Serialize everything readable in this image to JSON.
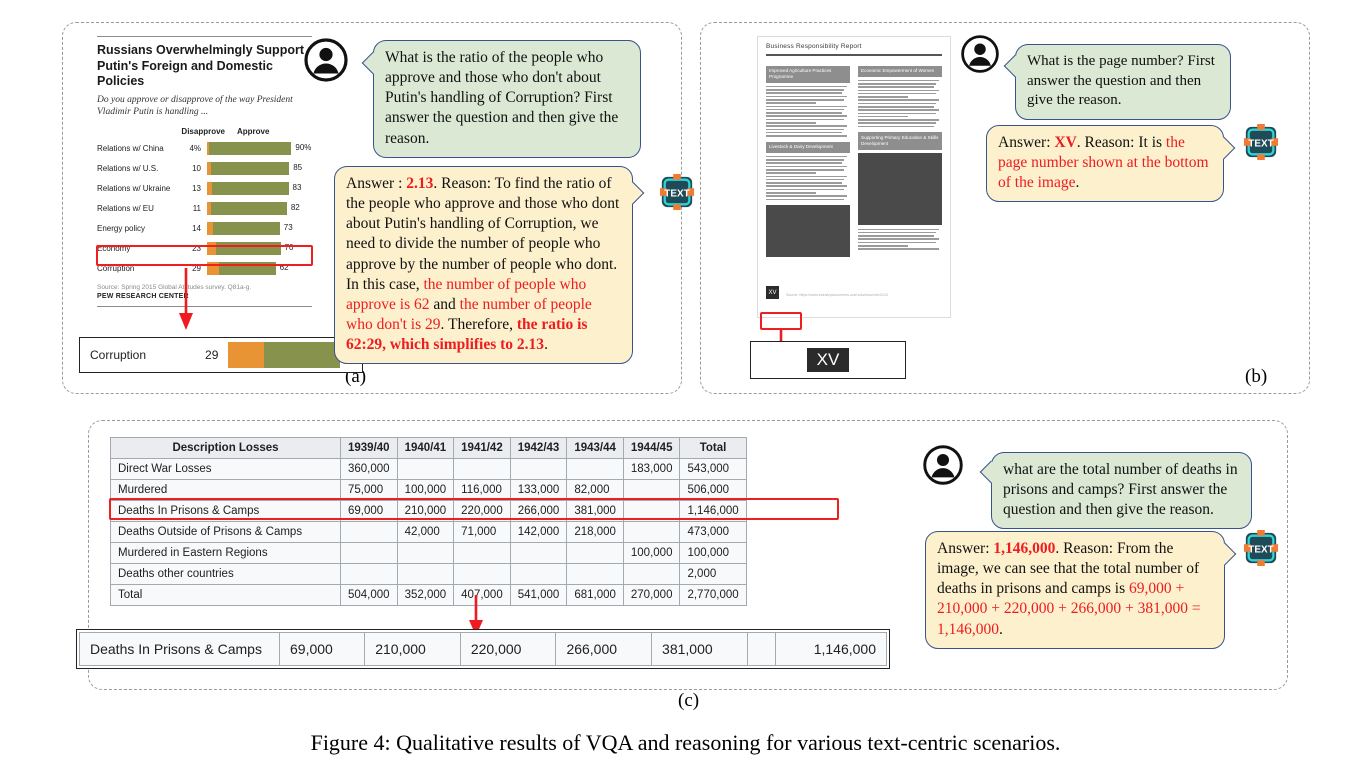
{
  "figure": {
    "caption": "Figure 4: Qualitative results of VQA and reasoning for various text-centric scenarios.",
    "panel_a_label": "(a)",
    "panel_b_label": "(b)",
    "panel_c_label": "(c)"
  },
  "colors": {
    "answer_red": "#ee1c20",
    "question_bubble": "#dbe8d4",
    "answer_bubble": "#fdf0cd",
    "bubble_border": "#38548c",
    "highlight_box": "#f01f1f",
    "bar_disapprove": "#e89434",
    "bar_approve": "#87924c"
  },
  "icons": {
    "user": "user-avatar-icon",
    "model": "text-model-icon",
    "model_label": "TEXT"
  },
  "panel_a": {
    "chart": {
      "title_line1": "Russians Overwhelmingly Support",
      "title_line2": "Putin's Foreign and Domestic Policies",
      "subtitle_line1": "Do you approve or disapprove of the way President",
      "subtitle_line2": "Vladimir Putin is handling ...",
      "col_disapprove": "Disapprove",
      "col_approve": "Approve",
      "source": "Source: Spring 2015 Global Attitudes survey. Q81a-g.",
      "org": "PEW RESEARCH CENTER"
    },
    "zoom_row": {
      "label": "Corruption",
      "disapprove": "29",
      "approve": "62"
    },
    "question": "What is the ratio of the people who approve and those who don't about Putin's handling of Corruption? First answer the question and then give the reason.",
    "answer": {
      "prefix": "Answer : ",
      "value": "2.13",
      "mid": ". Reason: To find the ratio of the people who approve and those who dont about Putin's handling of Corruption, we need to divide the number of people who approve by the number of people who dont. In this case, ",
      "red1": "the number of people who approve is 62",
      "joiner1": " and ",
      "red2": "the number of people who don't is 29",
      "joiner2": ". Therefore, ",
      "red_bold": "the ratio is 62:29, which simplifies to 2.13",
      "suffix": "."
    }
  },
  "panel_b": {
    "document": {
      "header": "Business Responsibility Report",
      "sections": [
        "Improved Agriculture Practices Programme",
        "Economic Empowerment of Women",
        "Livestock & Dairy Development",
        "Supporting Primary Education & Skills Development"
      ],
      "source": "Source: https://www.industrydocuments.ucsf.edu/docs/xrbx0123",
      "page_number": "XV"
    },
    "zoom_value": "XV",
    "question": "What is the page number? First answer the question and then give the reason.",
    "answer": {
      "prefix": "Answer: ",
      "value": "XV",
      "mid": ". Reason: It is ",
      "red": "the page number shown at the bottom of the image",
      "suffix": "."
    }
  },
  "panel_c": {
    "table": {
      "headers": [
        "Description Losses",
        "1939/40",
        "1940/41",
        "1941/42",
        "1942/43",
        "1943/44",
        "1944/45",
        "Total"
      ],
      "rows": [
        [
          "Direct War Losses",
          "360,000",
          "",
          "",
          "",
          "",
          "183,000",
          "543,000"
        ],
        [
          "Murdered",
          "75,000",
          "100,000",
          "116,000",
          "133,000",
          "82,000",
          "",
          "506,000"
        ],
        [
          "Deaths In Prisons & Camps",
          "69,000",
          "210,000",
          "220,000",
          "266,000",
          "381,000",
          "",
          "1,146,000"
        ],
        [
          "Deaths Outside of Prisons & Camps",
          "",
          "42,000",
          "71,000",
          "142,000",
          "218,000",
          "",
          "473,000"
        ],
        [
          "Murdered in Eastern Regions",
          "",
          "",
          "",
          "",
          "",
          "100,000",
          "100,000"
        ],
        [
          "Deaths other countries",
          "",
          "",
          "",
          "",
          "",
          "",
          "2,000"
        ],
        [
          "Total",
          "504,000",
          "352,000",
          "407,000",
          "541,000",
          "681,000",
          "270,000",
          "2,770,000"
        ]
      ],
      "highlighted_row_index": 2
    },
    "zoom_row": [
      "Deaths In Prisons & Camps",
      "69,000",
      "210,000",
      "220,000",
      "266,000",
      "381,000",
      "",
      "1,146,000"
    ],
    "question": "what are the total number of deaths in prisons and camps? First answer the question and then give the reason.",
    "answer": {
      "prefix": "Answer: ",
      "value": "1,146,000",
      "mid": ". Reason: From the image, we can see that the total number of deaths in prisons and camps is ",
      "red": "69,000 + 210,000 + 220,000 + 266,000 + 381,000 = 1,146,000",
      "suffix": "."
    }
  },
  "chart_data": {
    "type": "bar",
    "title": "Russians Overwhelmingly Support Putin's Foreign and Domestic Policies",
    "subtitle": "Do you approve or disapprove of the way President Vladimir Putin is handling ...",
    "categories": [
      "Relations w/ China",
      "Relations w/ U.S.",
      "Relations w/ Ukraine",
      "Relations w/ EU",
      "Energy policy",
      "Economy",
      "Corruption"
    ],
    "series": [
      {
        "name": "Disapprove",
        "values": [
          4,
          10,
          13,
          11,
          14,
          23,
          29
        ],
        "color": "#e89434"
      },
      {
        "name": "Approve",
        "values": [
          90,
          85,
          83,
          82,
          73,
          70,
          62
        ],
        "color": "#87924c"
      }
    ],
    "value_labels_disapprove": [
      "4%",
      "10",
      "13",
      "11",
      "14",
      "23",
      "29"
    ],
    "value_labels_approve": [
      "90%",
      "85",
      "83",
      "82",
      "73",
      "70",
      "62"
    ],
    "xlabel": "",
    "ylabel": "",
    "xlim": [
      0,
      100
    ],
    "grid": false,
    "legend_position": "top",
    "source": "Source: Spring 2015 Global Attitudes survey. Q81a-g.",
    "org": "PEW RESEARCH CENTER",
    "stacked": true
  }
}
